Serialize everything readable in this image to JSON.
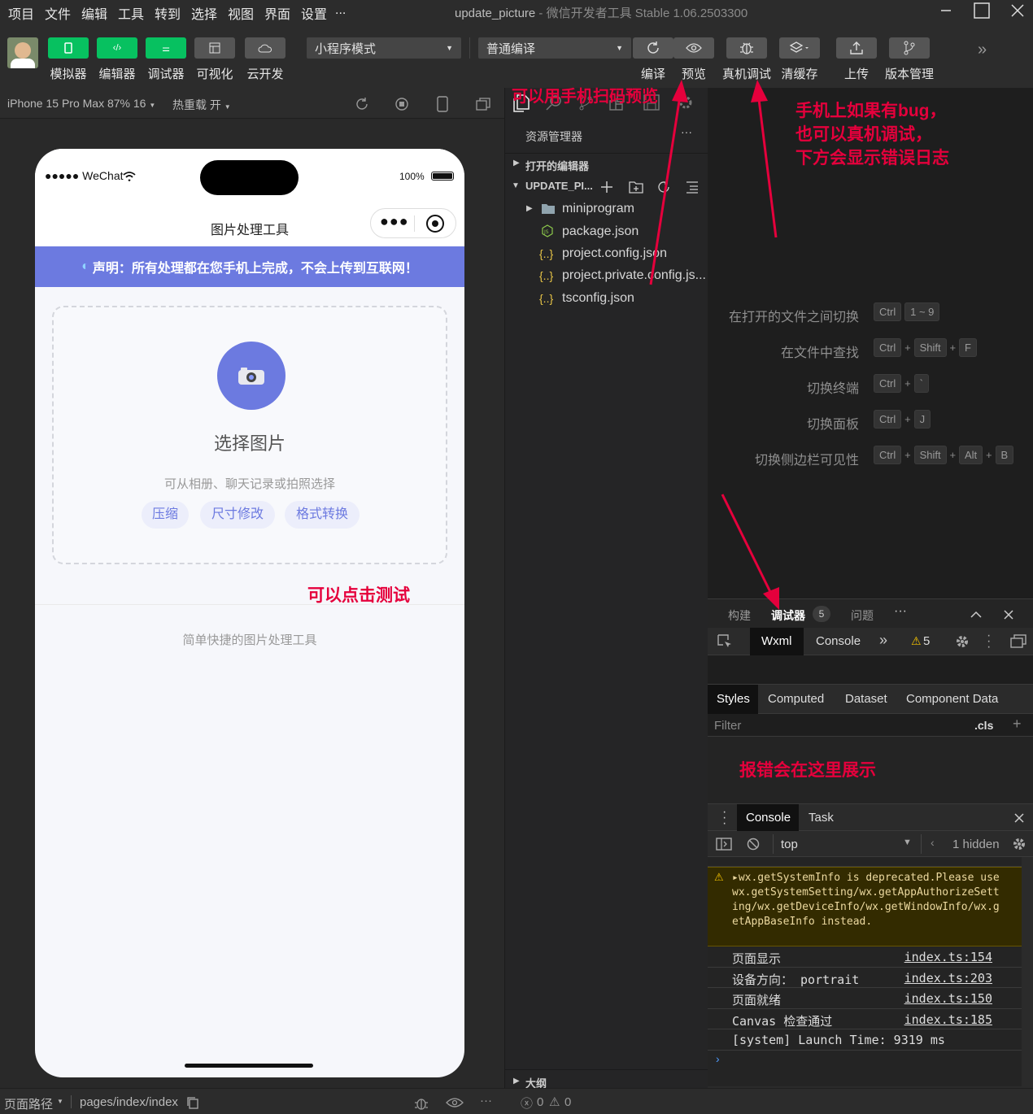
{
  "menu": [
    "项目",
    "文件",
    "编辑",
    "工具",
    "转到",
    "选择",
    "视图",
    "界面",
    "设置",
    "..."
  ],
  "window": {
    "title": "update_picture",
    "subtitle": "- 微信开发者工具 Stable 1.06.2503300"
  },
  "toolbar": {
    "simulator": "模拟器",
    "editor": "编辑器",
    "debugger": "调试器",
    "visual": "可视化",
    "cloud": "云开发",
    "mode": "小程序模式",
    "compile_mode": "普通编译",
    "compile": "编译",
    "preview": "预览",
    "realdebug": "真机调试",
    "clearcache": "清缓存",
    "upload": "上传",
    "version": "版本管理"
  },
  "simbar": {
    "device": "iPhone 15 Pro Max 87% 16",
    "hotreload": "热重载 开"
  },
  "phone": {
    "carrier": "●●●●● WeChat",
    "battery": "100%",
    "nav_title": "图片处理工具",
    "banner": "声明：所有处理都在您手机上完成，不会上传到互联网！",
    "choose": "选择图片",
    "hint": "可从相册、聊天记录或拍照选择",
    "tags": [
      "压缩",
      "尺寸修改",
      "格式转换"
    ],
    "footer": "简单快捷的图片处理工具"
  },
  "explorer": {
    "header": "资源管理器",
    "open_editors": "打开的编辑器",
    "project": "UPDATE_PI...",
    "files": [
      "miniprogram",
      "package.json",
      "project.config.json",
      "project.private.config.js...",
      "tsconfig.json"
    ],
    "outline": "大纲"
  },
  "shortcuts": [
    {
      "label": "在打开的文件之间切换",
      "keys": [
        "Ctrl",
        "1 ~ 9"
      ]
    },
    {
      "label": "在文件中查找",
      "keys": [
        "Ctrl",
        "Shift",
        "F"
      ]
    },
    {
      "label": "切换终端",
      "keys": [
        "Ctrl",
        "`"
      ]
    },
    {
      "label": "切换面板",
      "keys": [
        "Ctrl",
        "J"
      ]
    },
    {
      "label": "切换侧边栏可见性",
      "keys": [
        "Ctrl",
        "Shift",
        "Alt",
        "B"
      ]
    }
  ],
  "debug": {
    "tabs": [
      "构建",
      "调试器",
      "问题"
    ],
    "badge": "5",
    "subtabs": [
      "Wxml",
      "Console"
    ],
    "warn_count": "5",
    "style_tabs": [
      "Styles",
      "Computed",
      "Dataset",
      "Component Data"
    ],
    "filter": "Filter",
    "cls": ".cls",
    "drawer_tabs": [
      "Console",
      "Task"
    ],
    "context": "top",
    "hidden": "1 hidden",
    "warning": "▸wx.getSystemInfo is deprecated.Please use wx.getSystemSetting/wx.getAppAuthorizeSetting/wx.getDeviceInfo/wx.getWindowInfo/wx.getAppBaseInfo instead.",
    "logs": [
      {
        "msg": "页面显示",
        "src": "index.ts:154"
      },
      {
        "msg": "设备方向： portrait",
        "src": "index.ts:203"
      },
      {
        "msg": "页面就绪",
        "src": "index.ts:150"
      },
      {
        "msg": "Canvas 检查通过",
        "src": "index.ts:185"
      },
      {
        "msg": "[system] Launch Time: 9319 ms",
        "src": ""
      }
    ]
  },
  "status": {
    "path_label": "页面路径",
    "path": "pages/index/index",
    "errors": "0",
    "warnings": "0"
  },
  "annotations": {
    "scan": "可以用手机扫码预览",
    "realdebug": "手机上如果有bug，\n也可以真机调试，\n下方会显示错误日志",
    "click": "可以点击测试",
    "errors": "报错会在这里展示"
  }
}
